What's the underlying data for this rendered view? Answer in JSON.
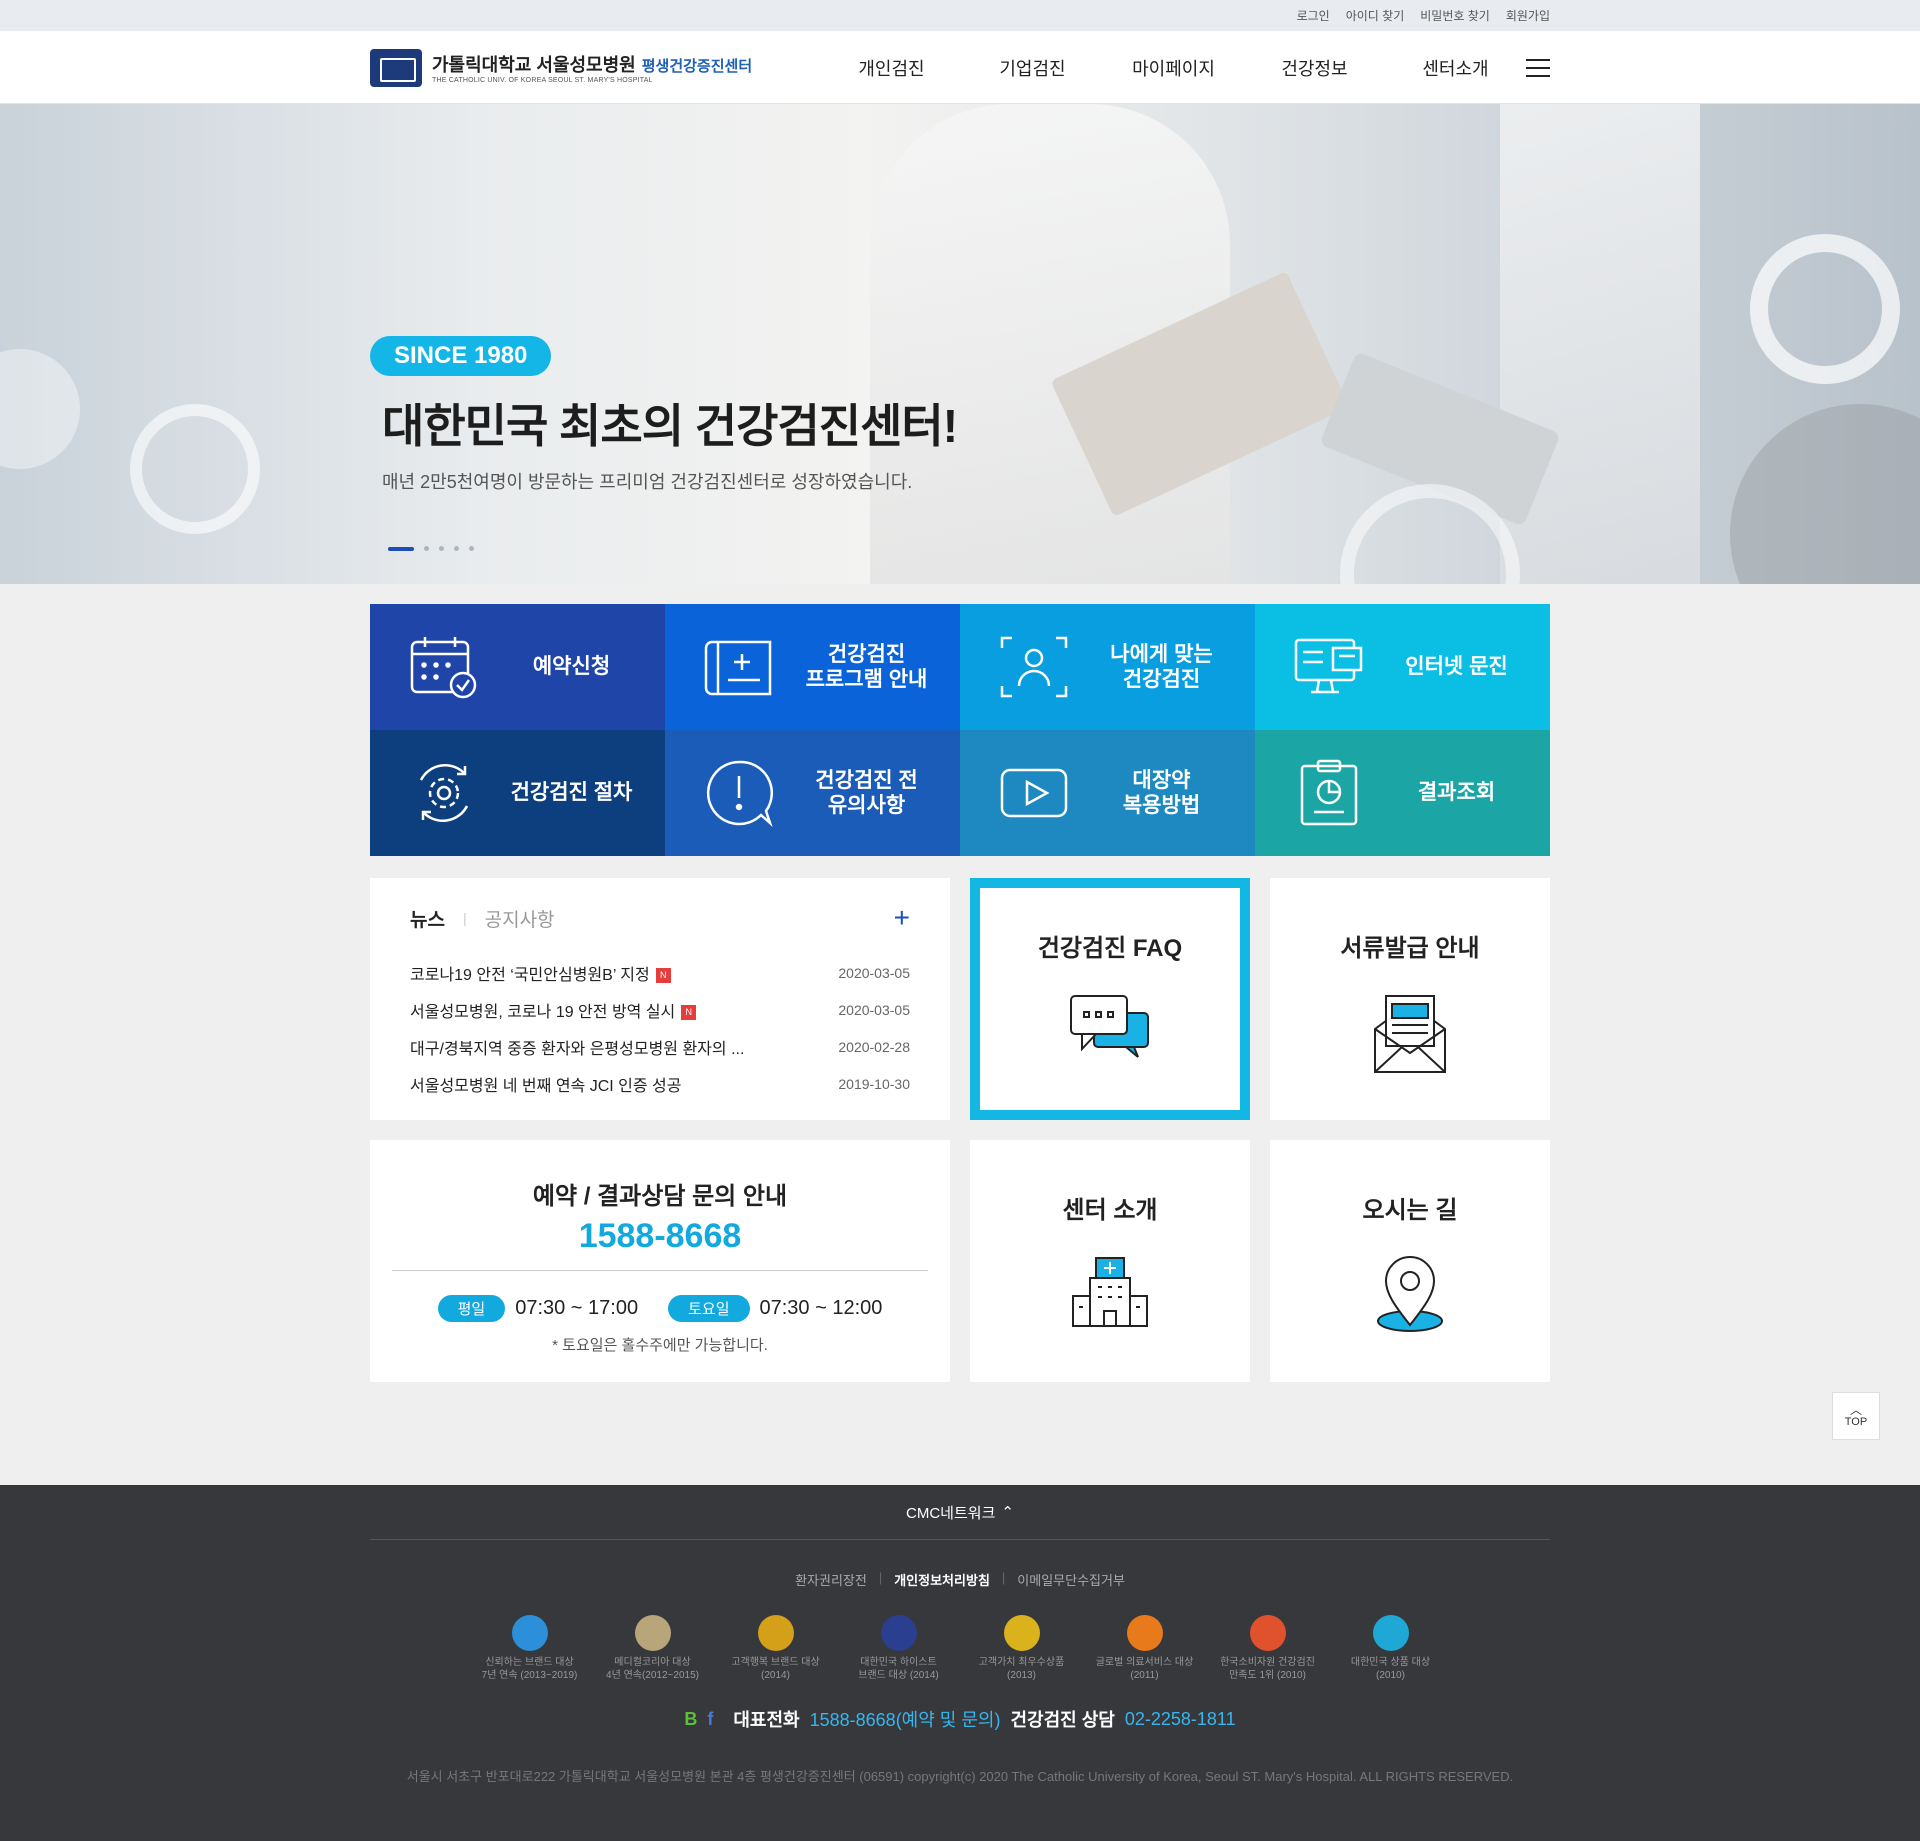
{
  "util": {
    "login": "로그인",
    "find_id": "아이디 찾기",
    "find_pw": "비밀번호 찾기",
    "join": "회원가입"
  },
  "logo": {
    "name_kr": "가톨릭대학교 서울성모병원",
    "sub_kr": "평생건강증진센터",
    "name_en": "THE CATHOLIC UNIV. OF KOREA SEOUL ST. MARY'S HOSPITAL"
  },
  "nav": {
    "items": [
      "개인검진",
      "기업검진",
      "마이페이지",
      "건강정보",
      "센터소개"
    ]
  },
  "hero": {
    "badge": "SINCE 1980",
    "title": "대한민국 최초의 건강검진센터!",
    "subtitle": "매년 2만5천여명이 방문하는 프리미엄 건강검진센터로 성장하였습니다."
  },
  "quick": [
    {
      "label": "예약신청",
      "color": "#1f45a9"
    },
    {
      "label": "건강검진\n프로그램 안내",
      "color": "#0a63d9"
    },
    {
      "label": "나에게 맞는\n건강검진",
      "color": "#099edf"
    },
    {
      "label": "인터넷 문진",
      "color": "#0bbfe4"
    },
    {
      "label": "건강검진 절차",
      "color": "#0d3e7d"
    },
    {
      "label": "건강검진 전\n유의사항",
      "color": "#1b5cb9"
    },
    {
      "label": "대장약\n복용방법",
      "color": "#1d89c0"
    },
    {
      "label": "결과조회",
      "color": "#1ba5a5"
    }
  ],
  "news": {
    "tab_news": "뉴스",
    "tab_notice": "공지사항",
    "items": [
      {
        "title": "코로나19 안전 ‘국민안심병원B’ 지정",
        "new": "N",
        "date": "2020-03-05"
      },
      {
        "title": "서울성모병원, 코로나 19 안전 방역 실시",
        "new": "N",
        "date": "2020-03-05"
      },
      {
        "title": "대구/경북지역 중증 환자와 은평성모병원 환자의 ...",
        "new": "",
        "date": "2020-02-28"
      },
      {
        "title": "서울성모병원 네 번째 연속 JCI 인증 성공",
        "new": "",
        "date": "2019-10-30"
      }
    ]
  },
  "boxes": {
    "faq": "건강검진 FAQ",
    "docs": "서류발급 안내",
    "center": "센터 소개",
    "map": "오시는 길"
  },
  "contact": {
    "title": "예약 / 결과상담 문의 안내",
    "phone": "1588-8668",
    "weekday_label": "평일",
    "weekday_hours": "07:30 ~ 17:00",
    "sat_label": "토요일",
    "sat_hours": "07:30 ~ 12:00",
    "note": "* 토요일은 홀수주에만 가능합니다."
  },
  "top_button": "TOP",
  "footer": {
    "network": "CMC네트워크",
    "links": [
      "환자권리장전",
      "개인정보처리방침",
      "이메일무단수집거부"
    ],
    "awards": [
      {
        "text": "신뢰하는 브랜드 대상\n7년 연속 (2013~2019)",
        "color": "#2b8fd9"
      },
      {
        "text": "메디컬코리아 대상\n4년 연속(2012~2015)",
        "color": "#b8a57a"
      },
      {
        "text": "고객행복 브랜드 대상\n(2014)",
        "color": "#d4a019"
      },
      {
        "text": "대한민국 하이스트\n브랜드 대상 (2014)",
        "color": "#2a3f8f"
      },
      {
        "text": "고객가치 최우수상품\n(2013)",
        "color": "#d9b21c"
      },
      {
        "text": "글로벌 의료서비스 대상\n(2011)",
        "color": "#e87a1c"
      },
      {
        "text": "한국소비자원 건강검진\n만족도 1위 (2010)",
        "color": "#e0512e"
      },
      {
        "text": "대한민국 상품 대상\n(2010)",
        "color": "#1fa7d6"
      }
    ],
    "blog": "B",
    "facebook": "f",
    "rep_label": "대표전화",
    "rep_value": "1588-8668(예약 및 문의)",
    "consult_label": "건강검진 상담",
    "consult_value": "02-2258-1811",
    "copyright": "서울시 서초구 반포대로222 가톨릭대학교 서울성모병원 본관 4층 평생건강증진센터 (06591) copyright(c) 2020 The Catholic University of Korea, Seoul ST. Mary's Hospital. ALL RIGHTS RESERVED."
  }
}
